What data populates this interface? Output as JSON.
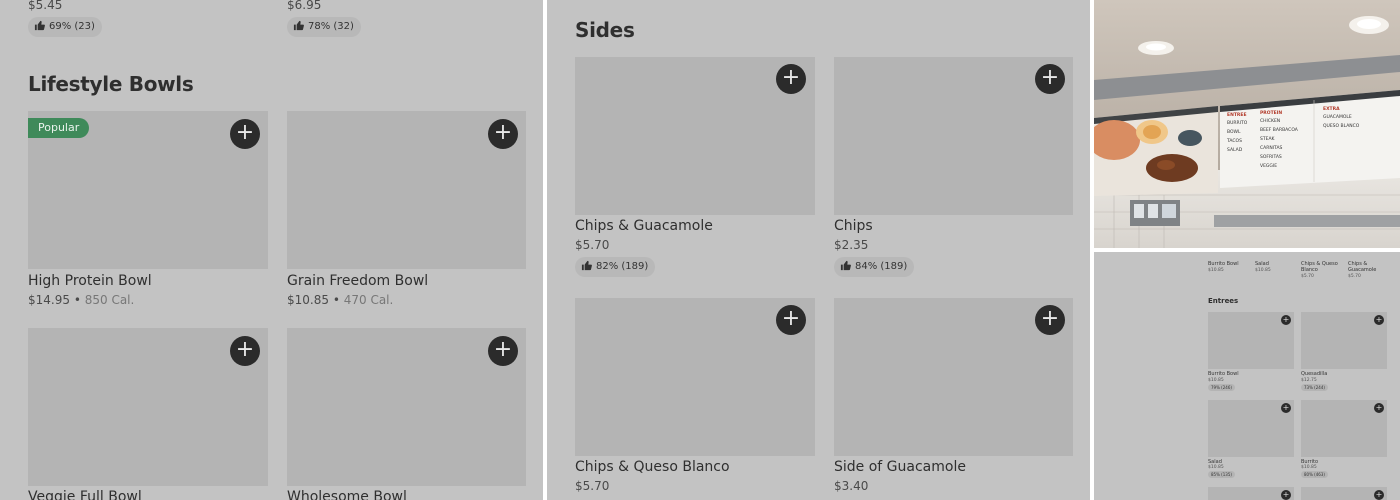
{
  "colors": {
    "panel_bg": "#c3c3c3",
    "image_placeholder": "#b4b4b4",
    "add_button": "#2b2b2b",
    "popular_badge": "#3f8a5a"
  },
  "left": {
    "top_items": [
      {
        "price": "$5.45",
        "rating": "69% (23)"
      },
      {
        "price": "$6.95",
        "rating": "78% (32)"
      }
    ],
    "section_title": "Lifestyle Bowls",
    "popular_badge": "Popular",
    "items": [
      {
        "name": "High Protein Bowl",
        "price": "$14.95",
        "calories": "850 Cal."
      },
      {
        "name": "Grain Freedom Bowl",
        "price": "$10.85",
        "calories": "470 Cal."
      },
      {
        "name": "Veggie Full Bowl"
      },
      {
        "name": "Wholesome Bowl"
      }
    ]
  },
  "middle": {
    "section_title": "Sides",
    "items": [
      {
        "name": "Chips & Guacamole",
        "price": "$5.70",
        "rating": "82% (189)"
      },
      {
        "name": "Chips",
        "price": "$2.35",
        "rating": "84% (189)"
      },
      {
        "name": "Chips & Queso Blanco",
        "price": "$5.70"
      },
      {
        "name": "Side of Guacamole",
        "price": "$3.40"
      }
    ]
  },
  "photo": {
    "menu_board": {
      "col1_header": "ENTREE",
      "col1": [
        "BURRITO",
        "BOWL",
        "TACOS",
        "SALAD"
      ],
      "col2_header": "PROTEIN",
      "col2": [
        "CHICKEN",
        "BEEF BARBACOA",
        "STEAK",
        "CARNITAS",
        "SOFRITAS",
        "VEGGIE"
      ],
      "col3_header": "EXTRA",
      "col3": [
        "GUACAMOLE",
        "QUESO BLANCO"
      ]
    }
  },
  "thumb": {
    "top_row": [
      {
        "name": "Burrito Bowl",
        "price": "$10.85"
      },
      {
        "name": "Salad",
        "price": "$10.85"
      },
      {
        "name": "Chips & Queso Blanco",
        "price": "$5.70"
      },
      {
        "name": "Chips & Guacamole",
        "price": "$5.70"
      }
    ],
    "section_title": "Entrees",
    "items": [
      {
        "name": "Burrito Bowl",
        "price": "$10.85",
        "rating": "79% (246)"
      },
      {
        "name": "Quesadilla",
        "price": "$12.75",
        "rating": "73% (244)"
      },
      {
        "name": "Salad",
        "price": "$10.85",
        "rating": "85% (135)"
      },
      {
        "name": "Burrito",
        "price": "$10.85",
        "rating": "80% (463)"
      }
    ]
  },
  "add_symbol": "+"
}
